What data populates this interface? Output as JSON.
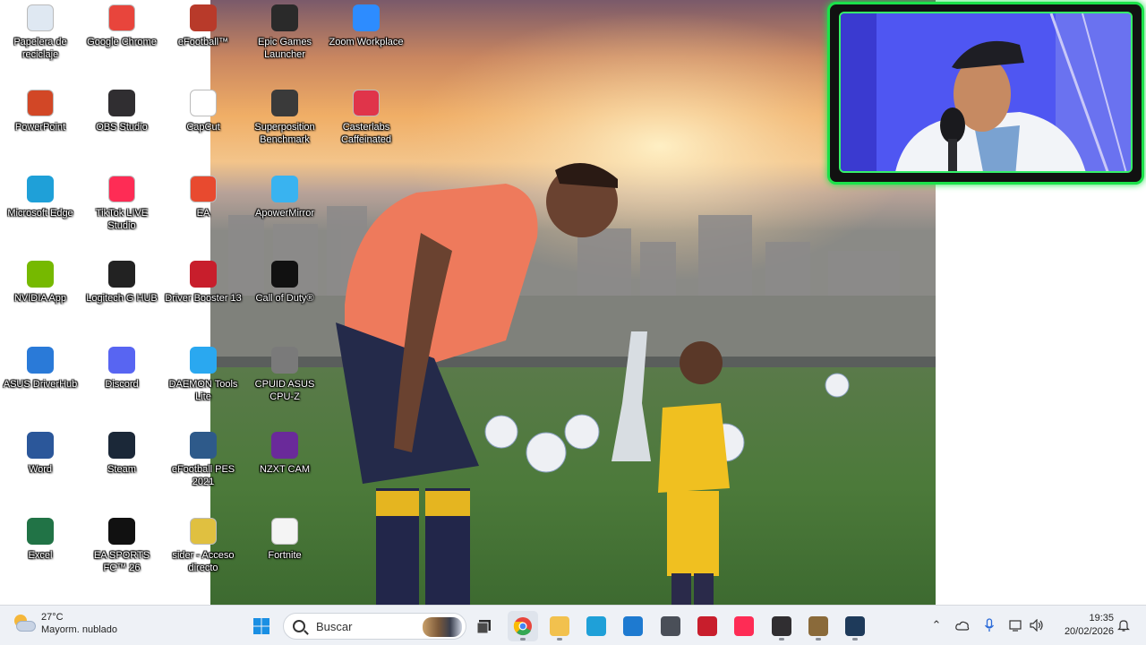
{
  "desktop": {
    "icons": [
      {
        "label": "Papelera de reciclaje",
        "icon": "recycle-bin-icon",
        "color": "#dfe8f2"
      },
      {
        "label": "Google Chrome",
        "icon": "chrome-icon",
        "color": "#e8453c"
      },
      {
        "label": "eFootball™",
        "icon": "efootball-icon",
        "color": "#b83a2a"
      },
      {
        "label": "Epic Games Launcher",
        "icon": "epic-games-icon",
        "color": "#2a2a2a"
      },
      {
        "label": "Zoom Workplace",
        "icon": "zoom-icon",
        "color": "#2d8cff"
      },
      {
        "label": "PowerPoint",
        "icon": "powerpoint-icon",
        "color": "#d24726"
      },
      {
        "label": "OBS Studio",
        "icon": "obs-icon",
        "color": "#302e31"
      },
      {
        "label": "CapCut",
        "icon": "capcut-icon",
        "color": "#ffffff"
      },
      {
        "label": "Superposition Benchmark",
        "icon": "superposition-icon",
        "color": "#3a3a3a"
      },
      {
        "label": "Casterlabs Caffeinated",
        "icon": "casterlabs-icon",
        "color": "#e0344a"
      },
      {
        "label": "Microsoft Edge",
        "icon": "edge-icon",
        "color": "#1fa0d8"
      },
      {
        "label": "TikTok LIVE Studio",
        "icon": "tiktok-live-icon",
        "color": "#fe2c55"
      },
      {
        "label": "EA",
        "icon": "ea-icon",
        "color": "#e84a2f"
      },
      {
        "label": "ApowerMirror",
        "icon": "apowermirror-icon",
        "color": "#39b3f0"
      },
      {
        "label": "NVIDIA App",
        "icon": "nvidia-icon",
        "color": "#76b900"
      },
      {
        "label": "Logitech G HUB",
        "icon": "logitech-icon",
        "color": "#222222"
      },
      {
        "label": "Driver Booster 13",
        "icon": "driver-booster-icon",
        "color": "#c81e2c"
      },
      {
        "label": "Call of Duty®",
        "icon": "call-of-duty-icon",
        "color": "#111111"
      },
      {
        "label": "ASUS DriverHub",
        "icon": "asus-driverhub-icon",
        "color": "#2a7ad8"
      },
      {
        "label": "Discord",
        "icon": "discord-icon",
        "color": "#5865f2"
      },
      {
        "label": "DAEMON Tools Lite",
        "icon": "daemon-tools-icon",
        "color": "#2aa8f0"
      },
      {
        "label": "CPUID ASUS CPU-Z",
        "icon": "cpu-z-icon",
        "color": "#7a7a7a"
      },
      {
        "label": "Word",
        "icon": "word-icon",
        "color": "#2b579a"
      },
      {
        "label": "Steam",
        "icon": "steam-icon",
        "color": "#1b2838"
      },
      {
        "label": "eFootball PES 2021",
        "icon": "pes-2021-icon",
        "color": "#2e5a8a"
      },
      {
        "label": "NZXT CAM",
        "icon": "nzxt-cam-icon",
        "color": "#6a2a9a"
      },
      {
        "label": "Excel",
        "icon": "excel-icon",
        "color": "#217346"
      },
      {
        "label": "EA SPORTS FC™ 26",
        "icon": "ea-fc-icon",
        "color": "#111111"
      },
      {
        "label": "sider - Acceso directo",
        "icon": "sider-icon",
        "color": "#e0c040"
      },
      {
        "label": "Fortnite",
        "icon": "file-icon",
        "color": "#f4f4f4"
      }
    ]
  },
  "taskbar": {
    "weather": {
      "temp": "27°C",
      "desc": "Mayorm. nublado"
    },
    "search_placeholder": "Buscar",
    "apps": [
      {
        "name": "start-button",
        "icon": "windows-icon",
        "color": "#0a7cd6"
      },
      {
        "name": "task-view-button",
        "icon": "task-view-icon",
        "color": "#3a3a3a"
      },
      {
        "name": "taskbar-chrome",
        "icon": "chrome-icon",
        "color": "#e8453c"
      },
      {
        "name": "taskbar-file-explorer",
        "icon": "folder-icon",
        "color": "#f2c14e"
      },
      {
        "name": "taskbar-edge",
        "icon": "edge-icon",
        "color": "#1fa0d8"
      },
      {
        "name": "taskbar-store",
        "icon": "store-icon",
        "color": "#1e7ad0"
      },
      {
        "name": "taskbar-app-cube",
        "icon": "cube-icon",
        "color": "#4a4f58"
      },
      {
        "name": "taskbar-driver-booster",
        "icon": "driver-booster-icon",
        "color": "#c81e2c"
      },
      {
        "name": "taskbar-tiktok-live",
        "icon": "tiktok-live-icon",
        "color": "#fe2c55"
      },
      {
        "name": "taskbar-obs",
        "icon": "obs-icon",
        "color": "#302e31"
      },
      {
        "name": "taskbar-tools",
        "icon": "tools-icon",
        "color": "#8a6a3a"
      },
      {
        "name": "taskbar-monitor",
        "icon": "monitor-icon",
        "color": "#1e3a5a"
      }
    ],
    "clock": {
      "time": "19:35",
      "date": "20/02/2026"
    }
  },
  "webcam": {
    "frame_color": "#1be24a"
  }
}
